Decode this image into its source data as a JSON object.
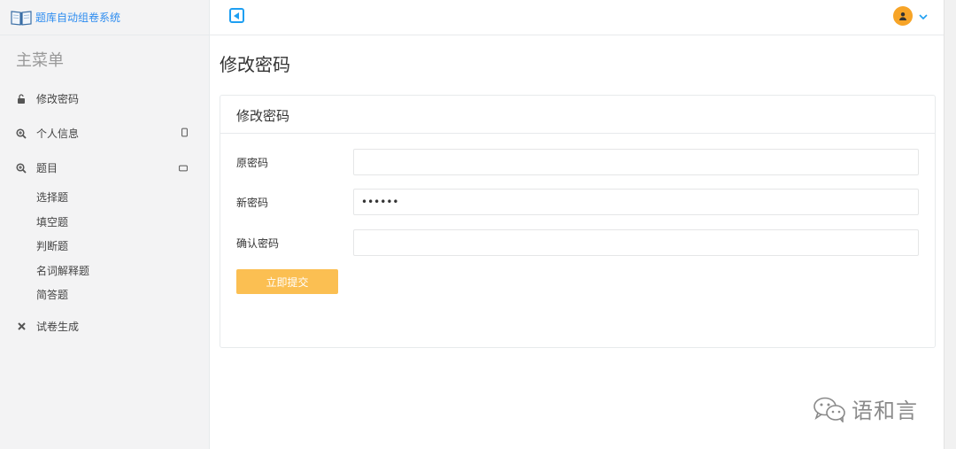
{
  "app": {
    "title": "题库自动组卷系统"
  },
  "sidebar": {
    "heading": "主菜单",
    "items": [
      {
        "label": "修改密码",
        "icon": "lock-icon"
      },
      {
        "label": "个人信息",
        "icon": "search-plus-icon"
      },
      {
        "label": "题目",
        "icon": "search-plus-icon",
        "children": [
          "选择题",
          "填空题",
          "判断题",
          "名词解释题",
          "简答题"
        ]
      },
      {
        "label": "试卷生成",
        "icon": "close-icon"
      }
    ]
  },
  "main": {
    "page_title": "修改密码",
    "panel_title": "修改密码",
    "fields": [
      {
        "label": "原密码",
        "value": ""
      },
      {
        "label": "新密码",
        "value": "••••••"
      },
      {
        "label": "确认密码",
        "value": ""
      }
    ],
    "submit_label": "立即提交"
  },
  "watermark": "语和言",
  "colors": {
    "brand": "#2d8cf0",
    "accent": "#fbbf52",
    "avatar": "#f7a427",
    "toggle": "#1e9ff2"
  }
}
